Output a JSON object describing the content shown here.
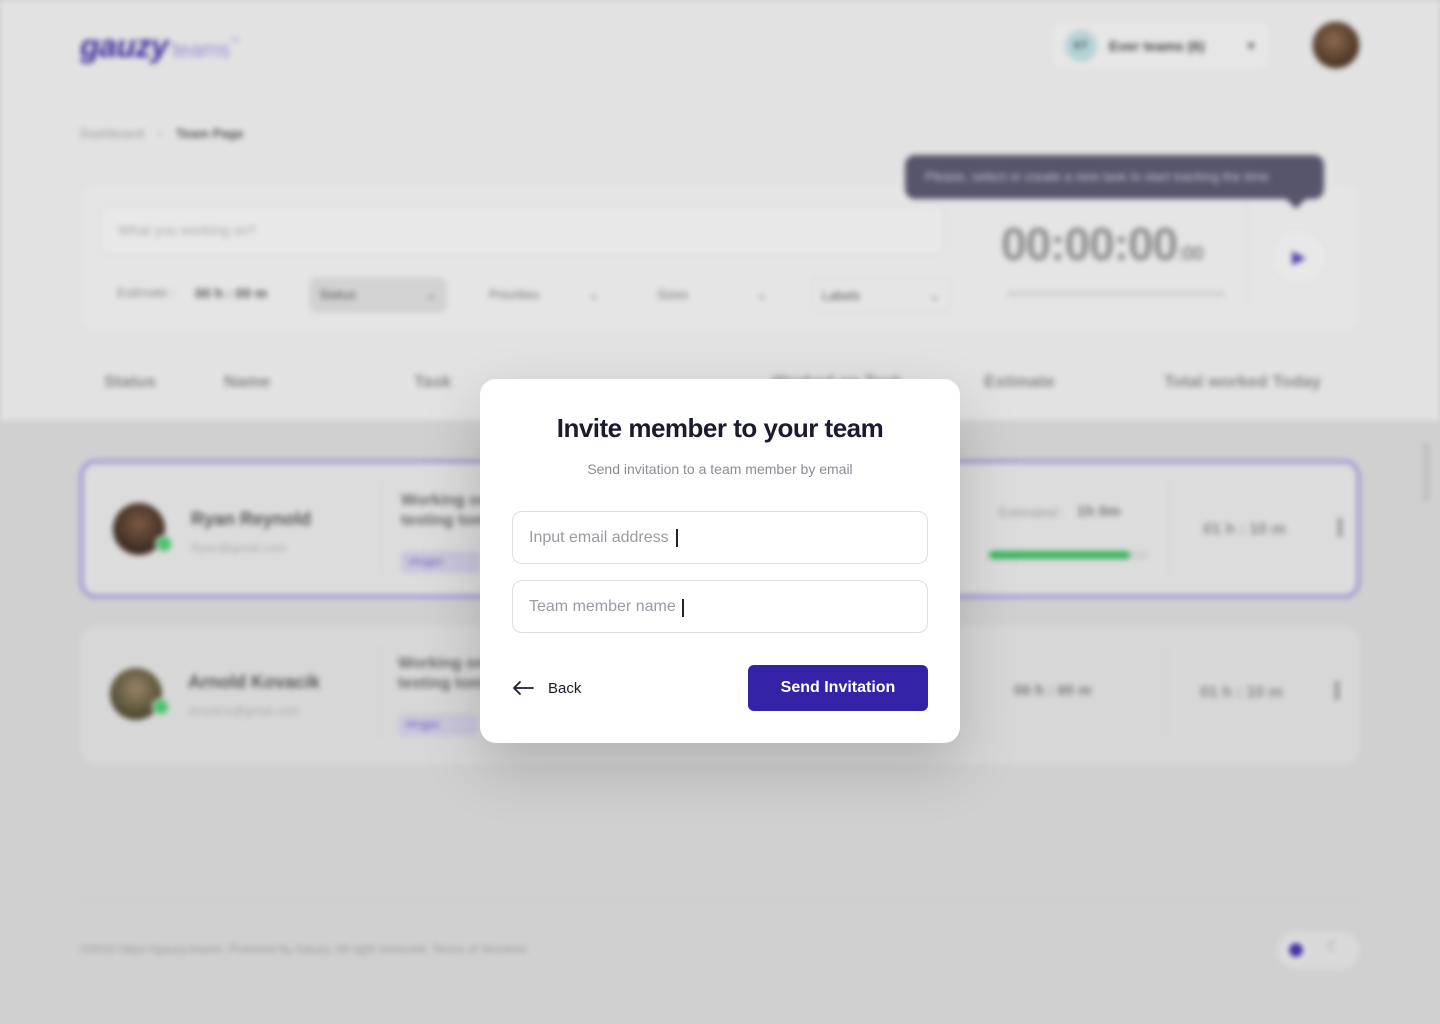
{
  "app": {
    "logo": "gauzy",
    "logo_sub": "teams",
    "logo_tm": "™"
  },
  "header": {
    "team_avatar": "ET",
    "team_name": "Ever teams (6)"
  },
  "breadcrumb": {
    "items": [
      "Dashboard",
      "Team Page"
    ]
  },
  "tracker": {
    "task_placeholder": "What you working on?",
    "estimate_label": "Estimate :",
    "estimate_value": "00 h : 00 m",
    "status_label": "Status",
    "priorities_label": "Priorities",
    "size_label": "Sizes",
    "labels_label": "Labels",
    "timer": "00:00:00",
    "timer_ms": ":00",
    "tooltip": "Please, select or create a new task to start tracking the time"
  },
  "table": {
    "columns": [
      "Status",
      "Name",
      "Task",
      "Worked on Task",
      "Estimate",
      "Total worked Today"
    ]
  },
  "members": [
    {
      "name": "Ryan Reynold",
      "email": "Ryan@gmail.com",
      "task": "Working on testing tom",
      "tag": "#Ingpo",
      "estimate_label": "Estimated :",
      "estimate_value": "1h 0m",
      "progress": 0.88,
      "worked_today": "01 h : 10 m"
    },
    {
      "name": "Arnold Kovacik",
      "email": "Arnold.k@gmail.com",
      "task": "Working on testing tom",
      "tag": "#Ingpo",
      "estimate_value": "00 h : 00 m",
      "worked_today": "01 h : 10 m"
    }
  ],
  "footer": {
    "text": "©2022 https://gauzy.teams. Powered by Gauzy. All right reserved. Terms of Services"
  },
  "modal": {
    "title": "Invite member to your team",
    "subtitle": "Send invitation to a team member by email",
    "email_placeholder": "Input email address",
    "name_placeholder": "Team member name",
    "back_label": "Back",
    "send_label": "Send Invitation"
  },
  "colors": {
    "primary": "#3423a6",
    "overlay": "#cfcfcf",
    "success": "#36b35b"
  }
}
